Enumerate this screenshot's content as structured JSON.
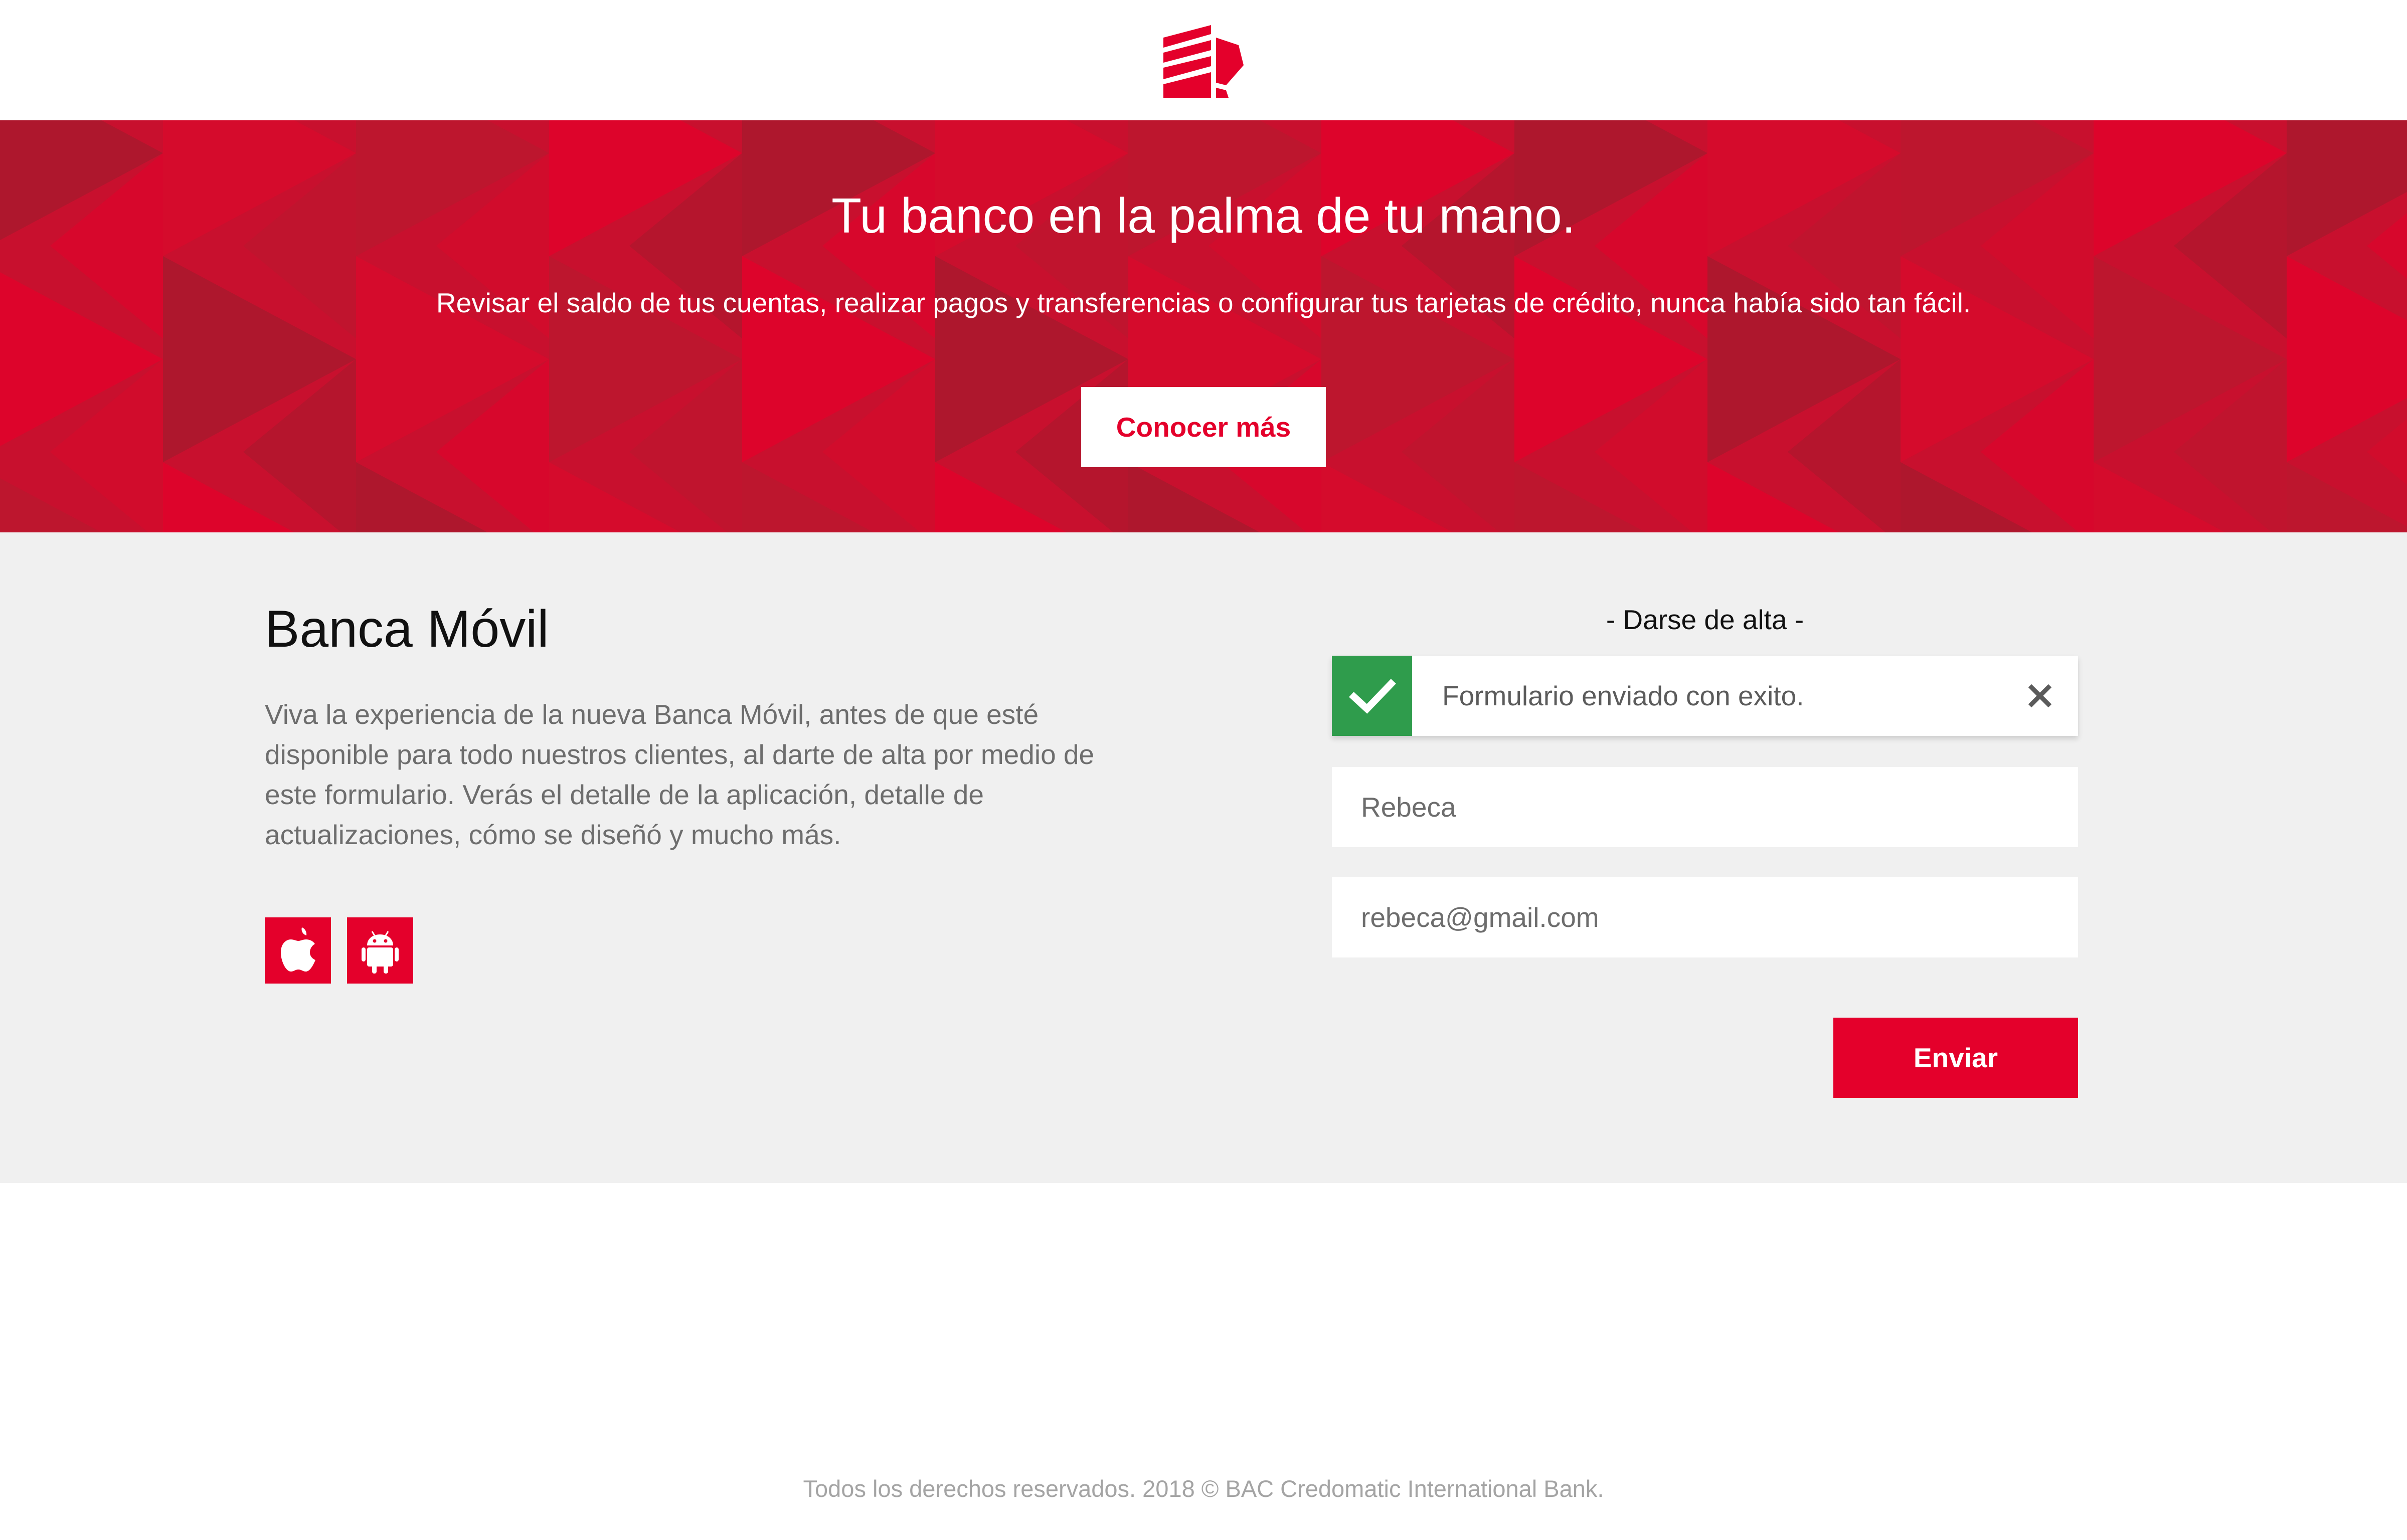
{
  "header": {
    "logo_icon": "bank-logo-icon",
    "brand_color": "#e4002b"
  },
  "hero": {
    "title": "Tu banco en la palma de tu mano.",
    "subtitle": "Revisar el saldo de tus cuentas, realizar pagos y transferencias o configurar tus tarjetas de crédito, nunca había sido tan fácil.",
    "cta_label": "Conocer más",
    "background_color": "#c8102e"
  },
  "main": {
    "title": "Banca Móvil",
    "description": "Viva la experiencia de la nueva Banca Móvil, antes de que esté disponible para todo nuestros clientes, al darte de alta por medio de este formulario. Verás el detalle de la aplicación, detalle de actualizaciones, cómo se diseñó y mucho más.",
    "store_buttons": [
      {
        "icon": "apple-icon"
      },
      {
        "icon": "android-icon"
      }
    ]
  },
  "form": {
    "heading": "- Darse de alta -",
    "alert": {
      "message": "Formulario enviado con exito.",
      "icon": "checkmark-icon",
      "close_icon": "close-icon",
      "status_color": "#2f9c4c"
    },
    "name_value": "Rebeca",
    "email_value": "rebeca@gmail.com",
    "submit_label": "Enviar"
  },
  "footer": {
    "text": "Todos los derechos reservados. 2018 © BAC Credomatic International Bank."
  }
}
